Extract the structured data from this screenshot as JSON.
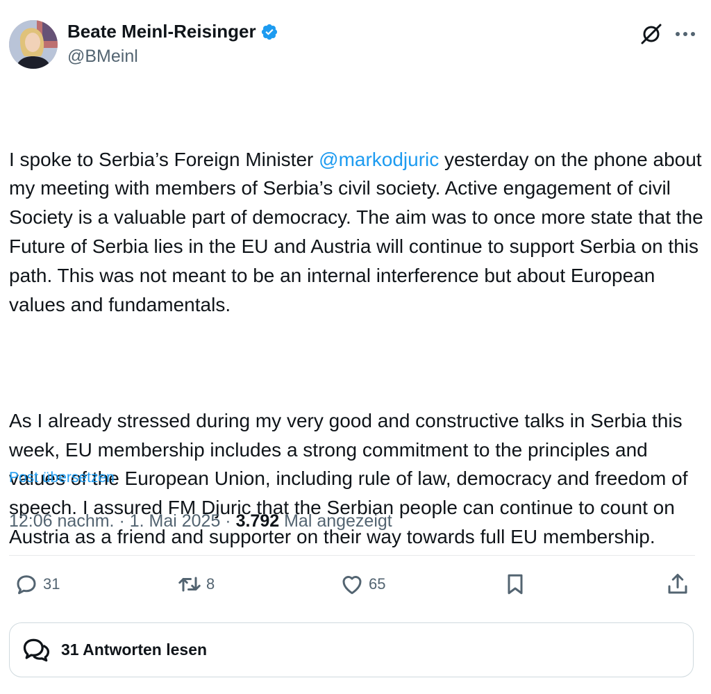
{
  "author": {
    "name": "Beate Meinl-Reisinger",
    "handle": "@BMeinl",
    "verified_color": "#1d9bf0"
  },
  "tweet": {
    "paragraph1_part1": "I spoke to Serbia’s Foreign Minister ",
    "mention": "@markodjuric",
    "paragraph1_part2": " yesterday on the phone about my meeting with members of Serbia’s civil society. Active engagement of civil Society is a valuable part of democracy. The aim was to once more state that the Future of Serbia lies in the EU and Austria will continue to support Serbia on this path. This was not meant to be an internal interference but about European values and fundamentals.",
    "paragraph2": "As I already stressed during my very good and constructive talks in Serbia this week, EU membership includes a strong commitment to the principles and values of the European Union, including rule of law, democracy and freedom of speech. I assured FM Djuric that the Serbian people can continue to count on Austria as a friend and supporter on their way towards full EU membership."
  },
  "translate_label": "Post übersetzen",
  "meta": {
    "time": "12:06 nachm.",
    "separator": " · ",
    "date": "1. Mai 2025",
    "views": "3.792",
    "views_label": " Mal angezeigt"
  },
  "actions": {
    "replies": "31",
    "reposts": "8",
    "likes": "65"
  },
  "icons": {
    "grok": "grok-icon",
    "more": "more-icon",
    "reply": "reply-icon",
    "repost": "repost-icon",
    "like": "heart-icon",
    "bookmark": "bookmark-icon",
    "share": "share-icon",
    "conversation": "conversation-icon"
  },
  "read_replies_label": "31 Antworten lesen",
  "colors": {
    "accent": "#1d9bf0",
    "text": "#0f1419",
    "secondary": "#536471"
  }
}
